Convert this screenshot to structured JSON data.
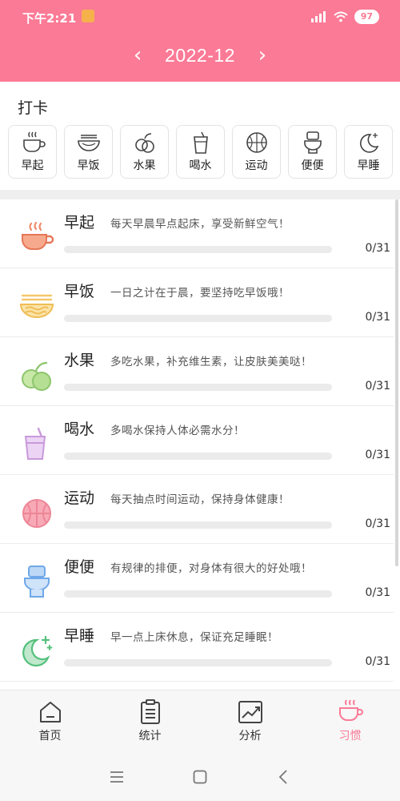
{
  "status": {
    "time": "下午2:21",
    "battery": "97"
  },
  "nav": {
    "prev": "‹",
    "next": "›",
    "month": "2022-12"
  },
  "checkin": {
    "title": "打卡",
    "chips": [
      {
        "label": "早起",
        "icon": "cup-icon"
      },
      {
        "label": "早饭",
        "icon": "bowl-icon"
      },
      {
        "label": "水果",
        "icon": "fruit-icon"
      },
      {
        "label": "喝水",
        "icon": "drink-icon"
      },
      {
        "label": "运动",
        "icon": "ball-icon"
      },
      {
        "label": "便便",
        "icon": "toilet-icon"
      },
      {
        "label": "早睡",
        "icon": "moon-icon"
      }
    ]
  },
  "habits": [
    {
      "name": "早起",
      "desc": "每天早晨早点起床，享受新鲜空气！",
      "count": "0/31",
      "progress": 0,
      "icon": "cup-icon",
      "color": "#ee8a6a"
    },
    {
      "name": "早饭",
      "desc": "一日之计在于晨，要坚持吃早饭哦！",
      "count": "0/31",
      "progress": 0,
      "icon": "noodle-bowl-icon",
      "color": "#f7c552"
    },
    {
      "name": "水果",
      "desc": "多吃水果，补充维生素，让皮肤美美哒！",
      "count": "0/31",
      "progress": 0,
      "icon": "fruit-icon",
      "color": "#9cd17c"
    },
    {
      "name": "喝水",
      "desc": "多喝水保持人体必需水分！",
      "count": "0/31",
      "progress": 0,
      "icon": "drink-icon",
      "color": "#d7a6e8"
    },
    {
      "name": "运动",
      "desc": "每天抽点时间运动，保持身体健康！",
      "count": "0/31",
      "progress": 0,
      "icon": "basketball-icon",
      "color": "#f0899b"
    },
    {
      "name": "便便",
      "desc": "有规律的排便，对身体有很大的好处哦！",
      "count": "0/31",
      "progress": 0,
      "icon": "toilet-icon",
      "color": "#6fa8e8"
    },
    {
      "name": "早睡",
      "desc": "早一点上床休息，保证充足睡眠！",
      "count": "0/31",
      "progress": 0,
      "icon": "moon-icon",
      "color": "#55c07c"
    }
  ],
  "tabs": [
    {
      "label": "首页",
      "icon": "home-icon"
    },
    {
      "label": "统计",
      "icon": "clipboard-icon"
    },
    {
      "label": "分析",
      "icon": "chart-icon"
    },
    {
      "label": "习惯",
      "icon": "cup-icon",
      "active": true
    }
  ],
  "colors": {
    "brand": "#fb7a96",
    "divider": "#efefef",
    "track": "#ebebeb"
  }
}
